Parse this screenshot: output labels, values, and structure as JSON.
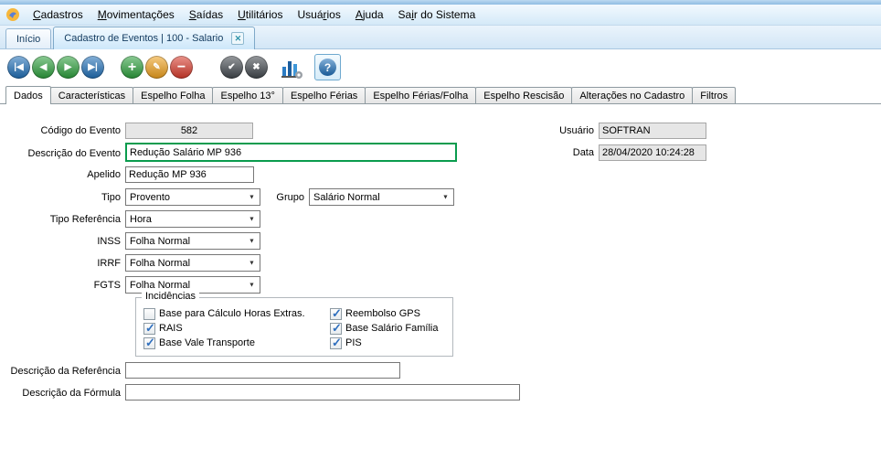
{
  "colors": {
    "focus_border": "#0a9c4e",
    "readonly_bg": "#e6e6e6",
    "blue_btn": "#1f6fb8",
    "green_btn": "#2ca03c",
    "orange_btn": "#f0a11c",
    "red_btn": "#d93a2b",
    "dark_btn": "#41474d"
  },
  "icons": {
    "dropdown_arrow": "▼"
  },
  "menu": {
    "items": [
      {
        "pre": "",
        "accel": "C",
        "post": "adastros"
      },
      {
        "pre": "",
        "accel": "M",
        "post": "ovimentações"
      },
      {
        "pre": "",
        "accel": "S",
        "post": "aídas"
      },
      {
        "pre": "",
        "accel": "U",
        "post": "tilitários"
      },
      {
        "pre": "Usuá",
        "accel": "r",
        "post": "ios"
      },
      {
        "pre": "",
        "accel": "A",
        "post": "juda"
      },
      {
        "pre": "Sa",
        "accel": "i",
        "post": "r do Sistema"
      }
    ]
  },
  "tabs": {
    "home": "Início",
    "active": "Cadastro de Eventos | 100 - Salario",
    "close_glyph": "✕"
  },
  "toolbar": {
    "first": "|◀",
    "previous": "◀",
    "next": "▶",
    "last": "▶|",
    "add": "+",
    "edit": "✎",
    "delete": "−",
    "confirm": "✔",
    "cancel": "✖",
    "help": "?"
  },
  "pagetabs": {
    "active": "Dados",
    "items": [
      "Dados",
      "Características",
      "Espelho Folha",
      "Espelho 13°",
      "Espelho Férias",
      "Espelho Férias/Folha",
      "Espelho Rescisão",
      "Alterações no Cadastro",
      "Filtros"
    ]
  },
  "form": {
    "codigo": {
      "label": "Código do Evento",
      "value": "582"
    },
    "usuario": {
      "label": "Usuário",
      "value": "SOFTRAN"
    },
    "descricao": {
      "label": "Descrição do Evento",
      "value": "Redução Salário MP 936"
    },
    "data": {
      "label": "Data",
      "value": "28/04/2020 10:24:28"
    },
    "apelido": {
      "label": "Apelido",
      "value": "Redução MP 936"
    },
    "tipo": {
      "label": "Tipo",
      "value": "Provento"
    },
    "grupo": {
      "label": "Grupo",
      "value": "Salário Normal"
    },
    "tipo_referencia": {
      "label": "Tipo Referência",
      "value": "Hora"
    },
    "inss": {
      "label": "INSS",
      "value": "Folha Normal"
    },
    "irrf": {
      "label": "IRRF",
      "value": "Folha Normal"
    },
    "fgts": {
      "label": "FGTS",
      "value": "Folha Normal"
    },
    "incidencias": {
      "legend": "Incidências",
      "items": [
        {
          "label": "Base para Cálculo Horas Extras.",
          "checked": false
        },
        {
          "label": "RAIS",
          "checked": true
        },
        {
          "label": "Base Vale Transporte",
          "checked": true
        },
        {
          "label": "Reembolso GPS",
          "checked": true
        },
        {
          "label": "Base Salário Família",
          "checked": true
        },
        {
          "label": "PIS",
          "checked": true
        }
      ]
    },
    "descricao_referencia": {
      "label": "Descrição da Referência",
      "value": ""
    },
    "descricao_formula": {
      "label": "Descrição da Fórmula",
      "value": ""
    }
  }
}
